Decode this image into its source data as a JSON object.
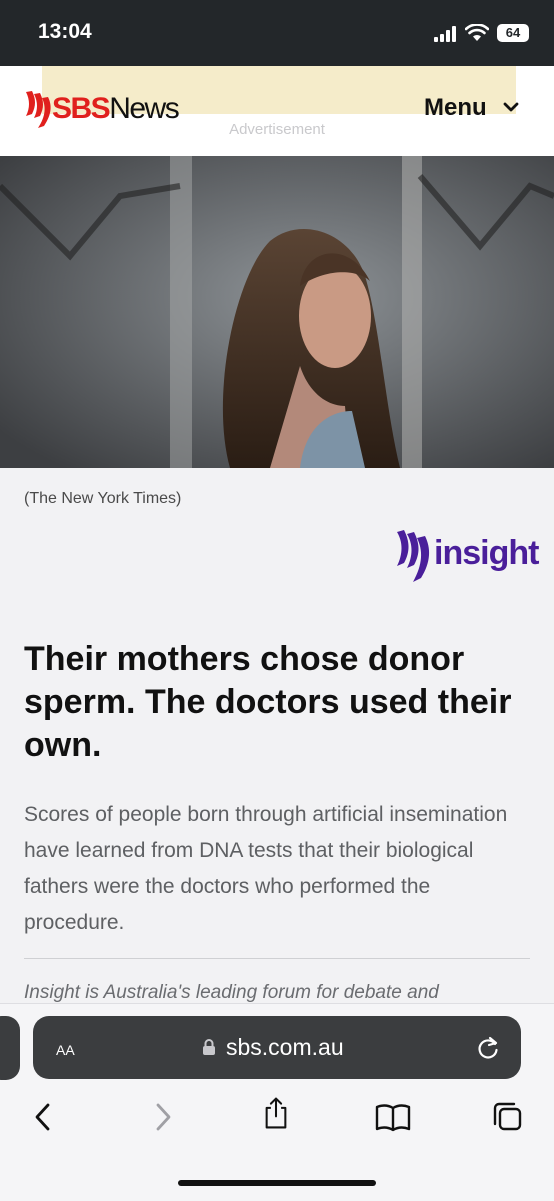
{
  "status_bar": {
    "time": "13:04",
    "battery": "64"
  },
  "header": {
    "advertisement_label": "Advertisement",
    "logo_sbs": "SBS",
    "logo_news": "News",
    "menu_label": "Menu"
  },
  "article": {
    "image_caption": "(The New York Times)",
    "program_logo_text": "insight",
    "headline": "Their mothers chose donor sperm. The doctors used their own.",
    "summary": "Scores of people born through artificial insemination have learned from DNA tests that their biological fathers were the doctors who performed the procedure.",
    "intro_partial": "Insight is Australia's leading forum for debate and"
  },
  "browser": {
    "text_size_label": "AA",
    "url": "sbs.com.au",
    "toolbar_icons": [
      "back-icon",
      "forward-icon",
      "share-icon",
      "bookmarks-icon",
      "tabs-icon"
    ]
  },
  "colors": {
    "sbs_red": "#e0201d",
    "insight_purple": "#4a1f9a",
    "status_bar": "#23272a",
    "url_bar": "#3b3d3f"
  }
}
